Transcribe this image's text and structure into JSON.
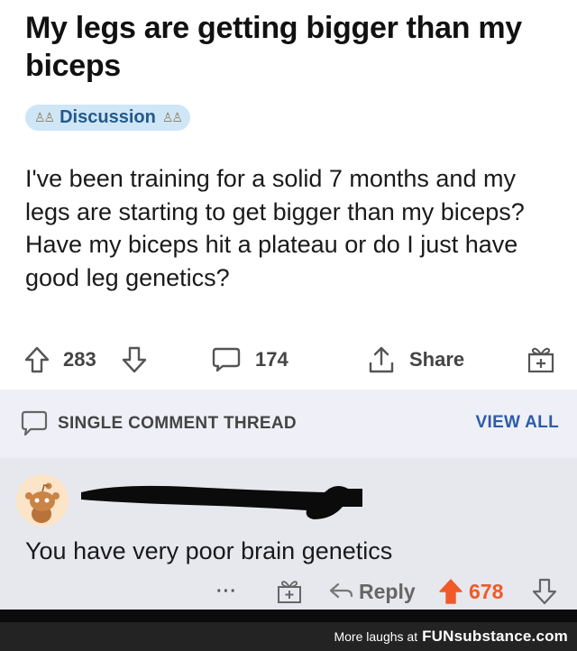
{
  "post": {
    "title": "My legs are getting bigger than my biceps",
    "flair": "Discussion",
    "body": "I've been training for a solid 7 months and my legs are starting to get bigger than my biceps? Have my biceps hit a plateau or do I just have good leg genetics?",
    "upvotes": "283",
    "comments": "174",
    "share_label": "Share"
  },
  "thread": {
    "label": "SINGLE COMMENT THREAD",
    "view_all": "VIEW ALL"
  },
  "comment": {
    "text": "You have very poor brain genetics",
    "dots": "···",
    "reply_label": "Reply",
    "score": "678"
  },
  "footer": {
    "prefix": "More laughs at",
    "brand": "FUNsubstance.com"
  },
  "colors": {
    "accent_blue": "#2d5ba8",
    "upvote_orange": "#f05a28",
    "flair_bg": "#cfe6f7"
  }
}
